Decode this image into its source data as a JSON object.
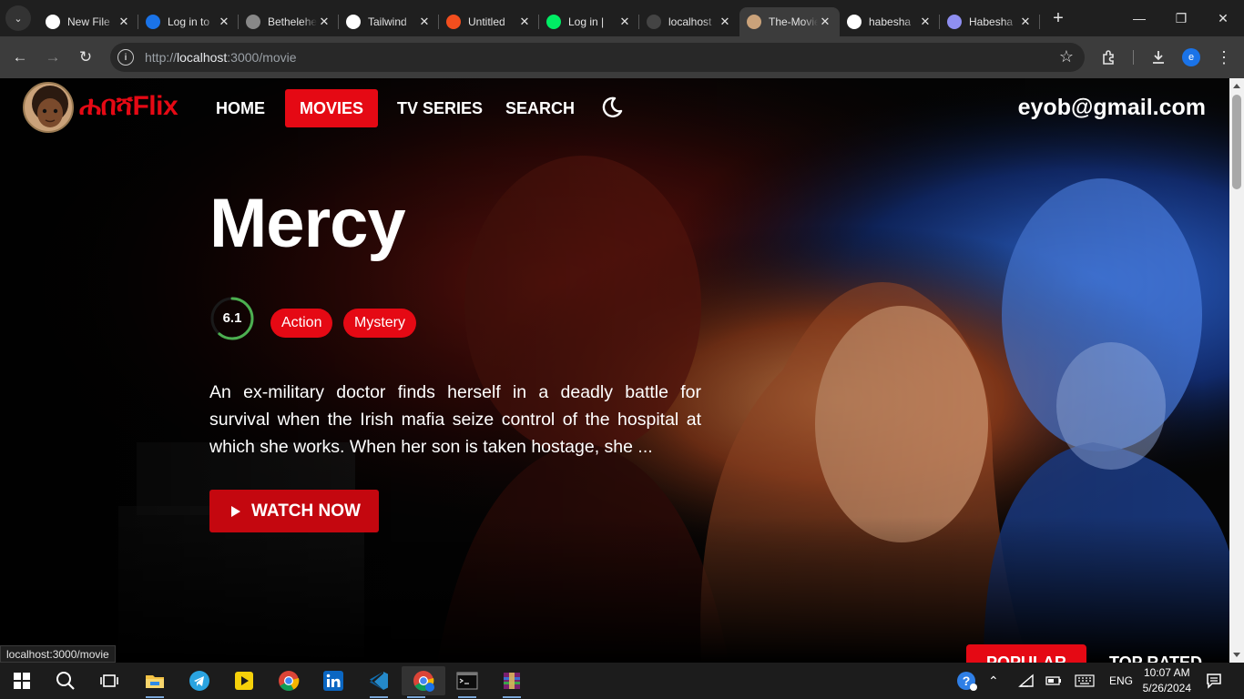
{
  "browser": {
    "tabs": [
      {
        "label": "New File",
        "icon": "github-icon",
        "color": "#ffffff"
      },
      {
        "label": "Log in to",
        "icon": "replit-icon",
        "color": "#1a73e8"
      },
      {
        "label": "Bethelehem",
        "icon": "site-icon",
        "color": "#888888"
      },
      {
        "label": "Tailwind",
        "icon": "openai-icon",
        "color": "#ffffff"
      },
      {
        "label": "Untitled",
        "icon": "figma-icon",
        "color": "#f24e1e"
      },
      {
        "label": "Log in |",
        "icon": "mongodb-icon",
        "color": "#00ed64"
      },
      {
        "label": "localhost",
        "icon": "github-icon",
        "color": "#444444"
      },
      {
        "label": "The-Movie",
        "icon": "avatar-icon",
        "color": "#caa27a"
      },
      {
        "label": "habesha",
        "icon": "google-icon",
        "color": "#ffffff"
      },
      {
        "label": "Habesha",
        "icon": "discord-icon",
        "color": "#8e8ef0"
      }
    ],
    "url_prefix": "http://",
    "url_host": "localhost",
    "url_rest": ":3000/movie",
    "profile_initial": "e"
  },
  "site": {
    "logo_text": "ሐበሻFlix",
    "nav": [
      "HOME",
      "MOVIES",
      "TV SERIES",
      "SEARCH"
    ],
    "active_nav": "MOVIES",
    "user_email": "eyob@gmail.com"
  },
  "movie": {
    "title": "Mercy",
    "rating": "6.1",
    "rating_fraction": 0.61,
    "genres": [
      "Action",
      "Mystery"
    ],
    "overview": "An ex-military doctor finds herself in a deadly battle for survival when the Irish mafia seize control of the hospital at which she works. When her son is taken hostage, she ...",
    "watch_label": "WATCH NOW"
  },
  "sections": {
    "tabs": [
      "POPULAR",
      "TOP RATED"
    ]
  },
  "status_bar": "localhost:3000/movie",
  "taskbar": {
    "lang": "ENG",
    "time": "10:07 AM",
    "date": "5/26/2024"
  },
  "colors": {
    "accent": "#e50914",
    "rating_ring": "#4caf50"
  }
}
